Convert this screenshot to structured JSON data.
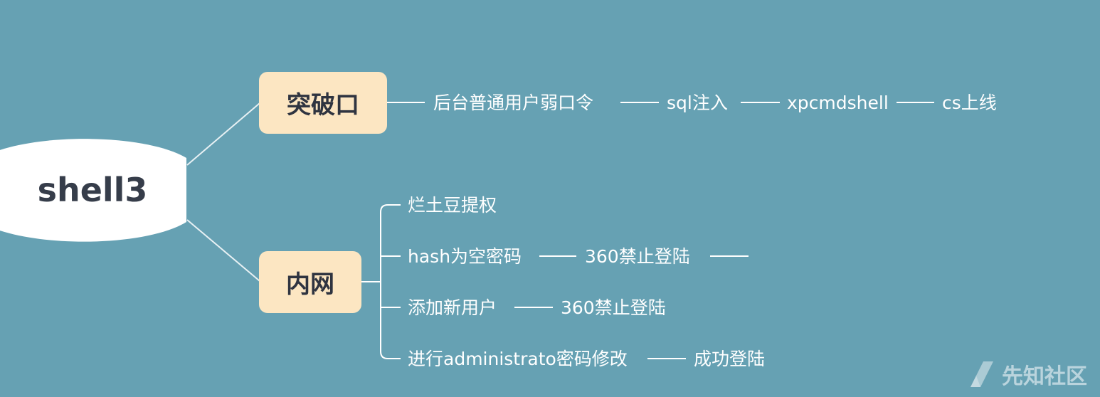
{
  "root": {
    "label": "shell3"
  },
  "branches": [
    {
      "label": "突破口",
      "chain": [
        "后台普通用户弱口令",
        "sql注入",
        "xpcmdshell",
        "cs上线"
      ]
    },
    {
      "label": "内网",
      "children": [
        {
          "chain": [
            "烂土豆提权"
          ]
        },
        {
          "chain": [
            "hash为空密码",
            "360禁止登陆"
          ],
          "trailing_connector": true
        },
        {
          "chain": [
            "添加新用户",
            "360禁止登陆"
          ]
        },
        {
          "chain": [
            "进行administrato密码修改",
            "成功登陆"
          ]
        }
      ]
    }
  ],
  "watermark": {
    "text": "先知社区",
    "icon": "xianzhi-logo-icon"
  },
  "colors": {
    "background": "#66a1b3",
    "branch_fill": "#fce6c2",
    "root_fill": "#ffffff",
    "line": "#ffffff"
  }
}
